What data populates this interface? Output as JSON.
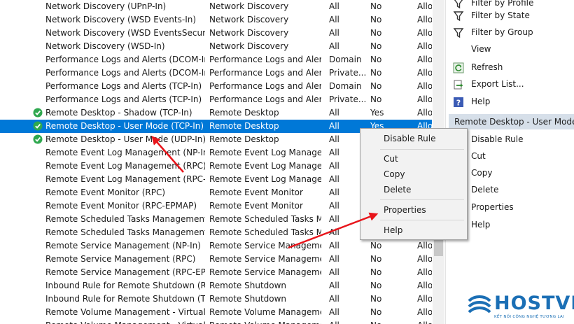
{
  "rules": [
    {
      "name": "Network Discovery (UPnP-In)",
      "group": "Network Discovery",
      "profile": "All",
      "enabled": "No",
      "action": "Allo",
      "icon": "none"
    },
    {
      "name": "Network Discovery (WSD Events-In)",
      "group": "Network Discovery",
      "profile": "All",
      "enabled": "No",
      "action": "Allo",
      "icon": "none"
    },
    {
      "name": "Network Discovery (WSD EventsSecure-In)",
      "group": "Network Discovery",
      "profile": "All",
      "enabled": "No",
      "action": "Allo",
      "icon": "none"
    },
    {
      "name": "Network Discovery (WSD-In)",
      "group": "Network Discovery",
      "profile": "All",
      "enabled": "No",
      "action": "Allo",
      "icon": "none"
    },
    {
      "name": "Performance Logs and Alerts (DCOM-In)",
      "group": "Performance Logs and Alerts",
      "profile": "Domain",
      "enabled": "No",
      "action": "Allo",
      "icon": "none"
    },
    {
      "name": "Performance Logs and Alerts (DCOM-In)",
      "group": "Performance Logs and Alerts",
      "profile": "Private...",
      "enabled": "No",
      "action": "Allo",
      "icon": "none"
    },
    {
      "name": "Performance Logs and Alerts (TCP-In)",
      "group": "Performance Logs and Alerts",
      "profile": "Domain",
      "enabled": "No",
      "action": "Allo",
      "icon": "none"
    },
    {
      "name": "Performance Logs and Alerts (TCP-In)",
      "group": "Performance Logs and Alerts",
      "profile": "Private...",
      "enabled": "No",
      "action": "Allo",
      "icon": "none"
    },
    {
      "name": "Remote Desktop - Shadow (TCP-In)",
      "group": "Remote Desktop",
      "profile": "All",
      "enabled": "Yes",
      "action": "Allo",
      "icon": "check"
    },
    {
      "name": "Remote Desktop - User Mode (TCP-In)",
      "group": "Remote Desktop",
      "profile": "All",
      "enabled": "Yes",
      "action": "Allo",
      "icon": "check",
      "selected": true
    },
    {
      "name": "Remote Desktop - User Mode (UDP-In)",
      "group": "Remote Desktop",
      "profile": "All",
      "enabled": "Yes",
      "action": "Allo",
      "icon": "check"
    },
    {
      "name": "Remote Event Log Management (NP-In)",
      "group": "Remote Event Log Manage...",
      "profile": "All",
      "enabled": "No",
      "action": "Allo",
      "icon": "none"
    },
    {
      "name": "Remote Event Log Management (RPC)",
      "group": "Remote Event Log Manage...",
      "profile": "All",
      "enabled": "No",
      "action": "Allo",
      "icon": "none"
    },
    {
      "name": "Remote Event Log Management (RPC-EP...",
      "group": "Remote Event Log Manage...",
      "profile": "All",
      "enabled": "No",
      "action": "Allo",
      "icon": "none"
    },
    {
      "name": "Remote Event Monitor (RPC)",
      "group": "Remote Event Monitor",
      "profile": "All",
      "enabled": "No",
      "action": "Allo",
      "icon": "none"
    },
    {
      "name": "Remote Event Monitor (RPC-EPMAP)",
      "group": "Remote Event Monitor",
      "profile": "All",
      "enabled": "No",
      "action": "Allo",
      "icon": "none"
    },
    {
      "name": "Remote Scheduled Tasks Management (...",
      "group": "Remote Scheduled Tasks M...",
      "profile": "All",
      "enabled": "No",
      "action": "Allo",
      "icon": "none"
    },
    {
      "name": "Remote Scheduled Tasks Management (...",
      "group": "Remote Scheduled Tasks M...",
      "profile": "All",
      "enabled": "No",
      "action": "Allo",
      "icon": "none"
    },
    {
      "name": "Remote Service Management (NP-In)",
      "group": "Remote Service Management",
      "profile": "All",
      "enabled": "No",
      "action": "Allo",
      "icon": "none"
    },
    {
      "name": "Remote Service Management (RPC)",
      "group": "Remote Service Management",
      "profile": "All",
      "enabled": "No",
      "action": "Allo",
      "icon": "none"
    },
    {
      "name": "Remote Service Management (RPC-EPM...",
      "group": "Remote Service Management",
      "profile": "All",
      "enabled": "No",
      "action": "Allo",
      "icon": "none"
    },
    {
      "name": "Inbound Rule for Remote Shutdown (RP...",
      "group": "Remote Shutdown",
      "profile": "All",
      "enabled": "No",
      "action": "Allo",
      "icon": "none"
    },
    {
      "name": "Inbound Rule for Remote Shutdown (TC...",
      "group": "Remote Shutdown",
      "profile": "All",
      "enabled": "No",
      "action": "Allo",
      "icon": "none"
    },
    {
      "name": "Remote Volume Management - Virtual Di...",
      "group": "Remote Volume Management",
      "profile": "All",
      "enabled": "No",
      "action": "Allo",
      "icon": "none"
    },
    {
      "name": "Remote Volume Management - Virtual Di...",
      "group": "Remote Volume Management",
      "profile": "All",
      "enabled": "No",
      "action": "Allo",
      "icon": "none"
    }
  ],
  "actions_top": [
    {
      "label": "Filter by Profile",
      "icon": "funnel-icon"
    },
    {
      "label": "Filter by State",
      "icon": "funnel-icon"
    },
    {
      "label": "Filter by Group",
      "icon": "funnel-icon"
    },
    {
      "label": "View",
      "icon": "none"
    },
    {
      "label": "Refresh",
      "icon": "refresh-icon"
    },
    {
      "label": "Export List...",
      "icon": "export-icon"
    },
    {
      "label": "Help",
      "icon": "help-icon"
    }
  ],
  "actions_section_title": "Remote Desktop - User Mode (TC",
  "actions_rule": [
    {
      "label": "Disable Rule"
    },
    {
      "label": "Cut"
    },
    {
      "label": "Copy"
    },
    {
      "label": "Delete"
    },
    {
      "label": "Properties"
    },
    {
      "label": "Help"
    }
  ],
  "context_menu": [
    {
      "label": "Disable Rule"
    },
    {
      "label": "Cut"
    },
    {
      "label": "Copy"
    },
    {
      "label": "Delete"
    },
    {
      "label": "Properties"
    },
    {
      "label": "Help"
    }
  ],
  "logo": {
    "brand": "HOSTVN",
    "tagline": "KẾT NỐI CÔNG NGHỆ TƯƠNG LAI"
  },
  "colors": {
    "selection": "#0078d7",
    "check": "#2fa84f",
    "arrow": "#e8151b",
    "brand": "#1b6fb5"
  }
}
